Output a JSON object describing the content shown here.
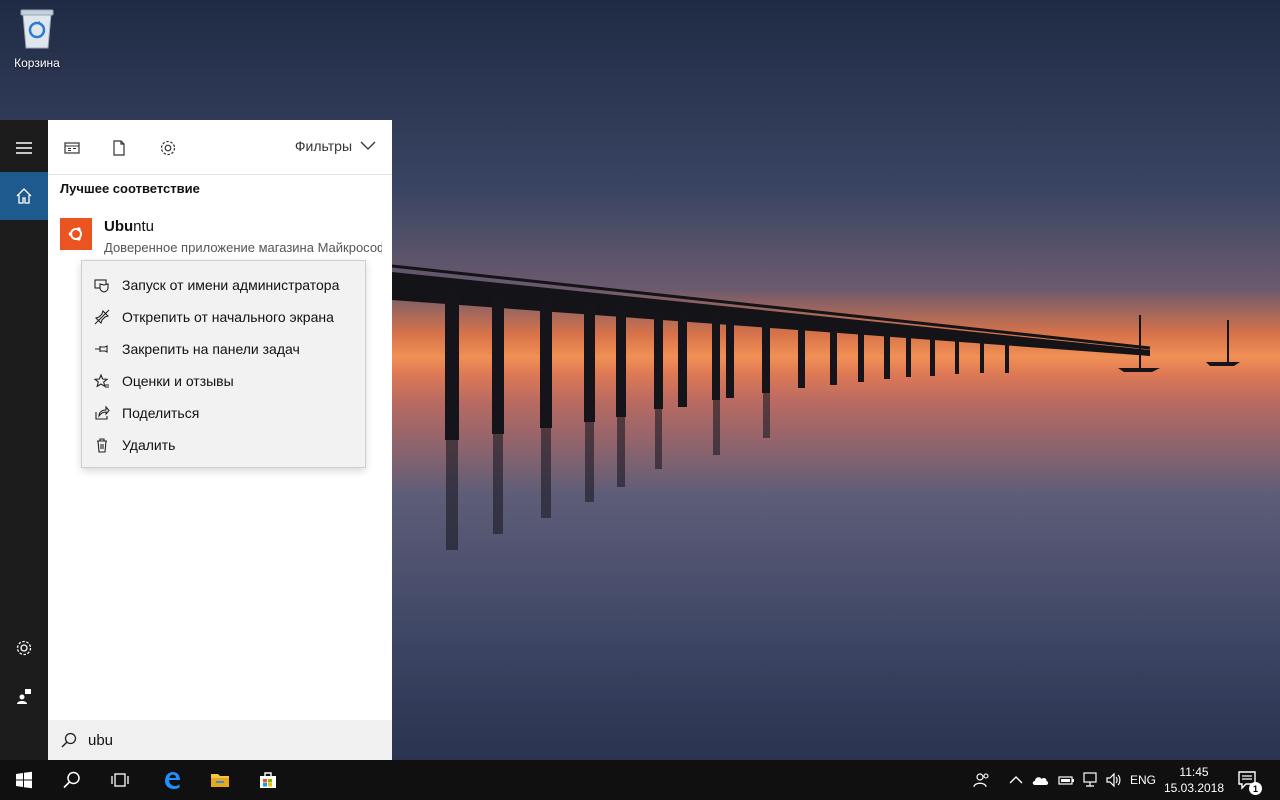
{
  "desktop": {
    "recycle_bin_label": "Корзина"
  },
  "rail": {
    "items": [
      {
        "icon": "hamburger-menu-icon"
      },
      {
        "icon": "home-icon",
        "active": true
      },
      {
        "icon": "gear-icon"
      },
      {
        "icon": "person-feedback-icon"
      }
    ]
  },
  "panel": {
    "top_icons": [
      "apps-icon",
      "documents-icon",
      "settings-gear-icon"
    ],
    "filters_label": "Фильтры",
    "best_match_label": "Лучшее соответствие",
    "result": {
      "name_bold": "Ubu",
      "name_rest": "ntu",
      "description": "Доверенное приложение магазина Майкрософт",
      "tile_color": "#e95420"
    },
    "context_menu": [
      {
        "icon": "shield-admin-icon",
        "label": "Запуск от имени администратора"
      },
      {
        "icon": "unpin-icon",
        "label": "Открепить от начального экрана"
      },
      {
        "icon": "pin-taskbar-icon",
        "label": "Закрепить на панели задач"
      },
      {
        "icon": "star-rating-icon",
        "label": "Оценки и отзывы"
      },
      {
        "icon": "share-icon",
        "label": "Поделиться"
      },
      {
        "icon": "trash-icon",
        "label": "Удалить"
      }
    ],
    "search": {
      "value": "ubu",
      "placeholder": ""
    }
  },
  "taskbar": {
    "apps": [
      "windows-start-icon",
      "search-icon",
      "task-view-icon",
      "edge-icon",
      "file-explorer-icon",
      "store-icon"
    ],
    "tray": [
      "people-icon",
      "chevron-up-icon",
      "onedrive-cloud-icon",
      "battery-icon",
      "network-icon",
      "volume-icon"
    ],
    "language": "ENG",
    "time": "11:45",
    "date": "15.03.2018",
    "notification_count": "1"
  },
  "colors": {
    "accent": "#1e5a8e",
    "rail_bg": "#1c1c1c",
    "taskbar_bg": "#101010",
    "ubuntu_orange": "#e95420"
  }
}
